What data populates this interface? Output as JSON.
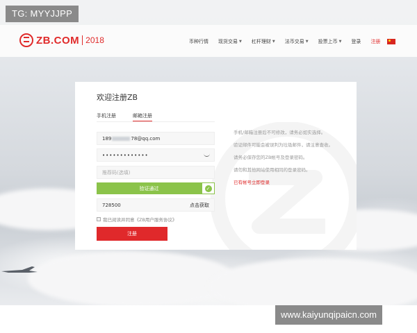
{
  "watermark": {
    "tag": "TG: MYYJJPP",
    "site": "www.kaiyunqipaicn.com"
  },
  "header": {
    "logo_text": "ZB.COM",
    "logo_year": "2018",
    "nav": [
      {
        "label": "币种行情",
        "dropdown": false
      },
      {
        "label": "现货交易",
        "dropdown": true
      },
      {
        "label": "杠杆理财",
        "dropdown": true
      },
      {
        "label": "法币交易",
        "dropdown": true
      },
      {
        "label": "投票上币",
        "dropdown": true
      },
      {
        "label": "登录",
        "dropdown": false
      },
      {
        "label": "注册",
        "dropdown": false
      }
    ],
    "flag_icon": "china-flag-icon"
  },
  "form": {
    "title": "欢迎注册ZB",
    "tabs": [
      {
        "label": "手机注册",
        "active": false
      },
      {
        "label": "邮箱注册",
        "active": true
      }
    ],
    "email_prefix": "189",
    "email_suffix": "78@qq.com",
    "password_mask": "•••••••••••••",
    "invite_placeholder": "推荐码(选填)",
    "verify_label": "验证通过",
    "code_value": "728500",
    "code_action": "点击获取",
    "agree_text": "我已阅读并同意《ZB用户服务协议》",
    "submit_label": "注册"
  },
  "tips": {
    "line1": "手机/邮箱注册后不可修改，请务必如实选择。",
    "line2": "验证邮件可能会被误判为垃圾邮件，请注意查收。",
    "line3": "请务必保存您的ZB帐号及登录密码。",
    "line4": "请勿和其他网站使用相同的登录密码。",
    "login_link": "已有帐号立即登录"
  },
  "colors": {
    "brand_red": "#e02a2a",
    "verify_green": "#8bc34a"
  }
}
